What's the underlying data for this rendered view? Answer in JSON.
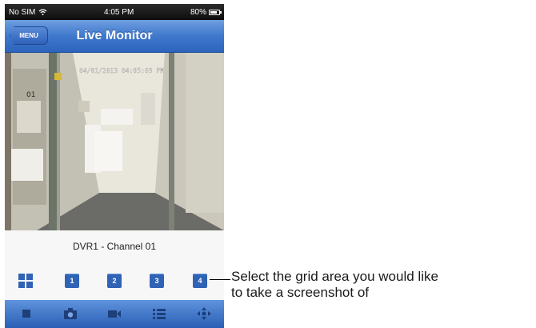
{
  "status_bar": {
    "carrier": "No SIM",
    "time": "4:05 PM",
    "battery": "80%"
  },
  "nav": {
    "menu_label": "MENU",
    "title": "Live Monitor"
  },
  "video": {
    "timestamp": "04/01/2013 04:05:03 PM",
    "room_sign": "01"
  },
  "channel_label": "DVR1 - Channel 01",
  "grid_buttons": [
    "1",
    "2",
    "3",
    "4"
  ],
  "annotation": {
    "line1": "Select the grid area you would like",
    "line2": "to take a screenshot of"
  },
  "colors": {
    "nav_blue": "#3f78cd",
    "button_blue": "#2f63b5"
  }
}
